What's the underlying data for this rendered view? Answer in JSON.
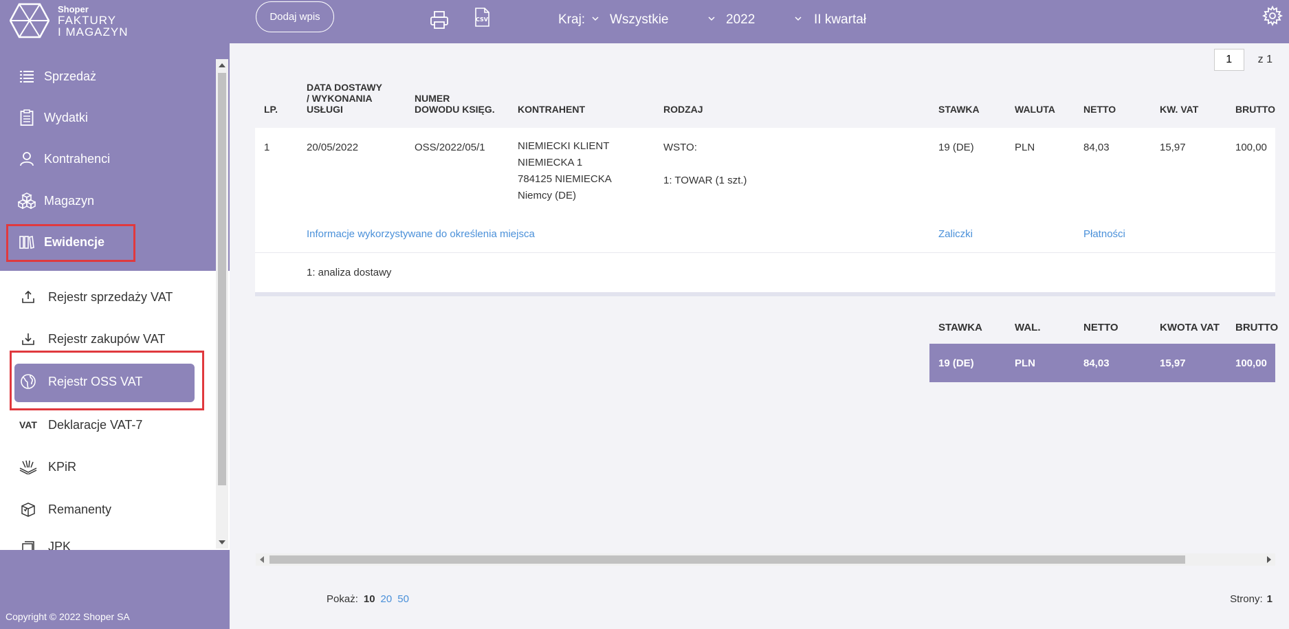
{
  "logo": {
    "small": "Shoper",
    "line1": "FAKTURY",
    "line2": "I MAGAZYN"
  },
  "sidebar": {
    "items": [
      {
        "label": "Sprzedaż",
        "icon": "list-icon"
      },
      {
        "label": "Wydatki",
        "icon": "clipboard-icon"
      },
      {
        "label": "Kontrahenci",
        "icon": "user-icon"
      },
      {
        "label": "Magazyn",
        "icon": "boxes-icon"
      },
      {
        "label": "Ewidencje",
        "icon": "book-icon"
      }
    ],
    "subitems": [
      {
        "label": "Rejestr sprzedaży VAT",
        "icon": "upload-icon"
      },
      {
        "label": "Rejestr zakupów VAT",
        "icon": "download-icon"
      },
      {
        "label": "Rejestr OSS VAT",
        "icon": "globe-icon"
      },
      {
        "label": "Deklaracje VAT-7",
        "icon_text": "VAT"
      },
      {
        "label": "KPiR",
        "icon": "books-icon"
      },
      {
        "label": "Remanenty",
        "icon": "checklist-box-icon"
      },
      {
        "label": "JPK",
        "icon": "documents-icon"
      }
    ],
    "copyright": "Copyright © 2022 Shoper SA"
  },
  "topbar": {
    "add_label": "Dodaj wpis",
    "country_label": "Kraj:",
    "country_value": "Wszystkie",
    "year_value": "2022",
    "quarter_value": "II kwartał"
  },
  "pager": {
    "page": "1",
    "of": "z 1"
  },
  "table": {
    "headers": {
      "lp": "LP.",
      "date": [
        "DATA DOSTAWY",
        "/ WYKONANIA",
        "USŁUGI"
      ],
      "number": [
        "NUMER",
        "DOWODU KSIĘG."
      ],
      "contractor": "KONTRAHENT",
      "kind": "RODZAJ",
      "rate": "STAWKA",
      "currency": "WALUTA",
      "net": "NETTO",
      "vat": "KW. VAT",
      "gross": "BRUTTO"
    },
    "rows": [
      {
        "lp": "1",
        "date": "20/05/2022",
        "number": "OSS/2022/05/1",
        "contractor": [
          "NIEMIECKI KLIENT",
          "NIEMIECKA 1",
          "784125 NIEMIECKA",
          "Niemcy (DE)"
        ],
        "kind": [
          "WSTO:",
          "",
          "1: TOWAR (1 szt.)"
        ],
        "rate": "19 (DE)",
        "currency": "PLN",
        "net": "84,03",
        "vat": "15,97",
        "gross": "100,00",
        "link_info": "Informacje wykorzystywane do określenia miejsca",
        "link_advances": "Zaliczki",
        "link_payments": "Płatności",
        "analysis": "1: analiza dostawy"
      }
    ]
  },
  "summary": {
    "headers": {
      "rate": "STAWKA",
      "currency": "WAL.",
      "net": "NETTO",
      "vat": "KWOTA VAT",
      "gross": "BRUTTO"
    },
    "row": {
      "rate": "19 (DE)",
      "currency": "PLN",
      "net": "84,03",
      "vat": "15,97",
      "gross": "100,00"
    }
  },
  "footer": {
    "show_label": "Pokaż:",
    "show_current": "10",
    "show_options": [
      "20",
      "50"
    ],
    "pages_label": "Strony:",
    "pages_value": "1"
  },
  "colors": {
    "accent": "#8d84b9",
    "highlight": "#e0393e",
    "link": "#4a90d9"
  }
}
